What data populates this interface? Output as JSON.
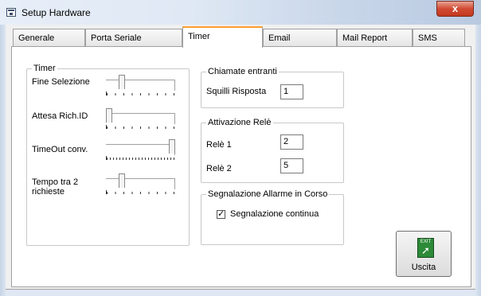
{
  "window": {
    "title": "Setup Hardware",
    "close_label": "x"
  },
  "tabs": [
    {
      "label": "Generale"
    },
    {
      "label": "Porta Seriale"
    },
    {
      "label": "Timer"
    },
    {
      "label": "Email"
    },
    {
      "label": "Mail Report"
    },
    {
      "label": "SMS"
    }
  ],
  "active_tab": "Timer",
  "timer": {
    "legend": "Timer",
    "fine_selezione": {
      "label": "Fine Selezione",
      "position": 0.2
    },
    "attesa_rich": {
      "label": "Attesa Rich.ID",
      "position": 0.0
    },
    "timeout_conv": {
      "label": "TimeOut conv.",
      "position": 1.0
    },
    "tempo_tra": {
      "label_line1": "Tempo tra 2",
      "label_line2": "richieste",
      "position": 0.2
    }
  },
  "chiamate": {
    "legend": "Chiamate entranti",
    "squilli_label": "Squilli Risposta",
    "squilli_value": "1"
  },
  "attivazione": {
    "legend": "Attivazione Relè",
    "rele1_label": "Relè 1",
    "rele1_value": "2",
    "rele2_label": "Relè 2",
    "rele2_value": "5"
  },
  "segnalazione": {
    "legend": "Segnalazione Allarme in Corso",
    "checkbox_label": "Segnalazione continua",
    "checked": true
  },
  "exit": {
    "icon_text": "EXIT",
    "label": "Uscita"
  }
}
